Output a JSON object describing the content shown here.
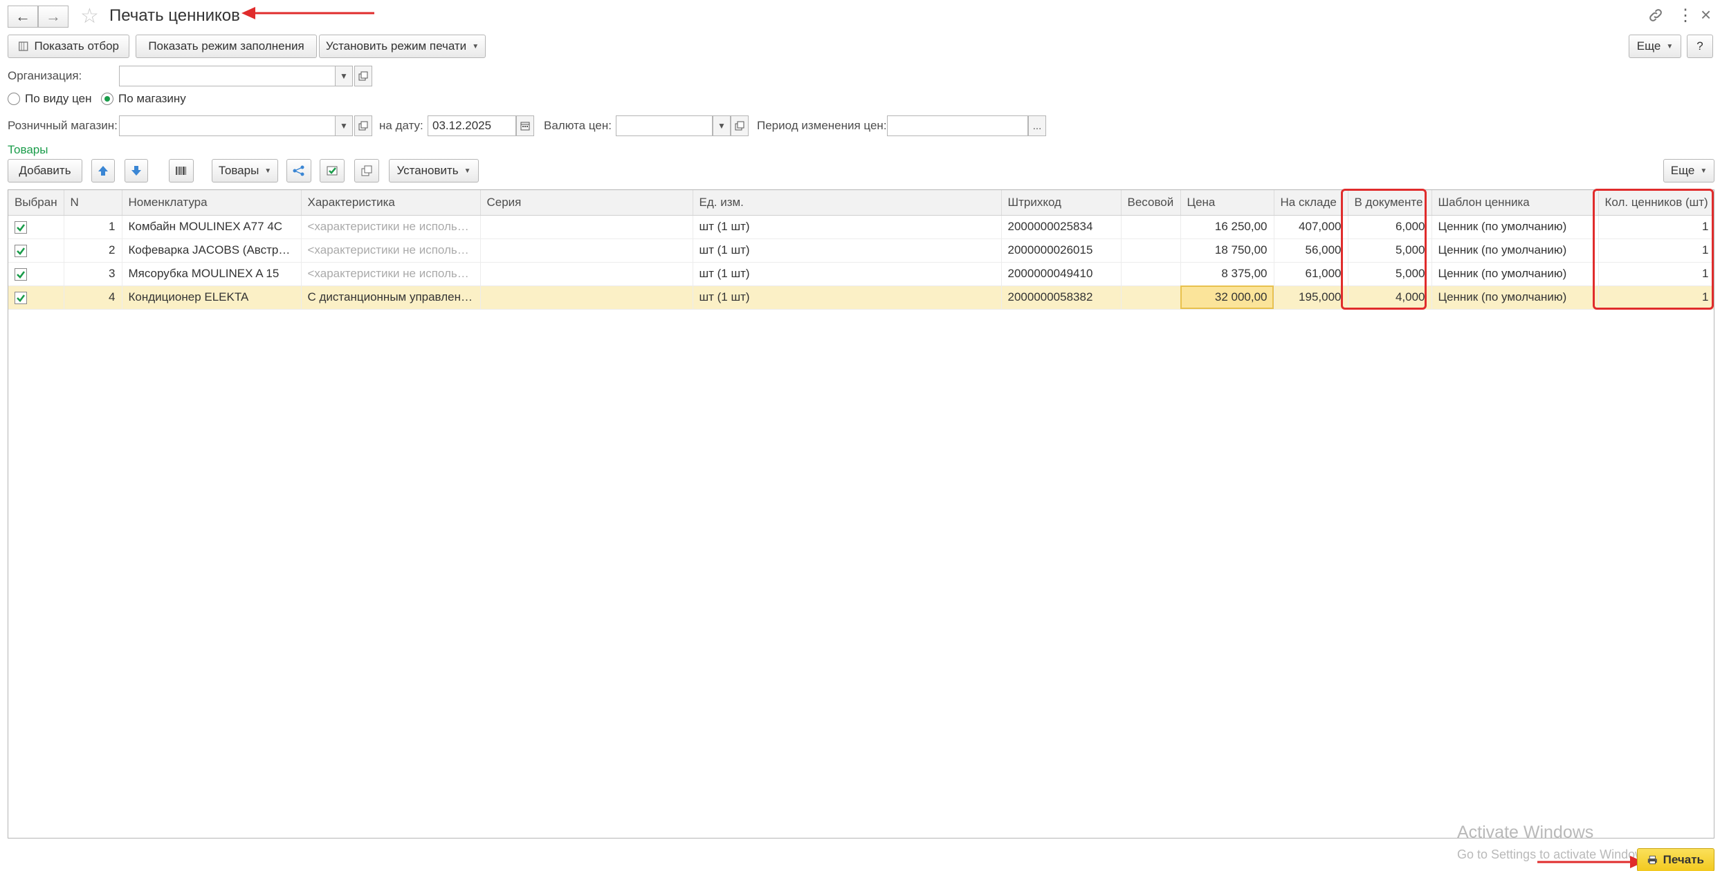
{
  "window": {
    "title": "Печать ценников"
  },
  "toolbar": {
    "show_filter": "Показать отбор",
    "show_fill_mode": "Показать режим заполнения",
    "set_print_mode": "Установить режим печати",
    "more": "Еще",
    "help": "?"
  },
  "filters": {
    "organization_label": "Организация:",
    "organization_value": "",
    "radio_by_price_type": "По виду цен",
    "radio_by_store": "По магазину",
    "radio_selected": "По магазину",
    "store_label": "Розничный магазин:",
    "store_value": "",
    "date_label": "на дату:",
    "date_value": "03.12.2025",
    "currency_label": "Валюта цен:",
    "currency_value": "",
    "period_label": "Период изменения цен:",
    "period_value": "",
    "period_btn": "..."
  },
  "goods": {
    "section_title": "Товары",
    "add": "Добавить",
    "goods_menu": "Товары",
    "set_menu": "Установить",
    "more": "Еще"
  },
  "table": {
    "columns": [
      "Выбран",
      "N",
      "Номенклатура",
      "Характеристика",
      "Серия",
      "Ед. изм.",
      "Штрихкод",
      "Весовой",
      "Цена",
      "На складе",
      "В документе",
      "Шаблон ценника",
      "Кол. ценников (шт)"
    ],
    "rows": [
      {
        "checked": true,
        "n": "1",
        "nomenclature": "Комбайн MOULINEX  A77 4C",
        "characteristic": "<характеристики не используются>",
        "series": "",
        "unit": "шт (1 шт)",
        "barcode": "2000000025834",
        "weight": "",
        "price": "16 250,00",
        "stock": "407,000",
        "in_doc": "6,000",
        "template": "Ценник (по умолчанию)",
        "count": "1"
      },
      {
        "checked": true,
        "n": "2",
        "nomenclature": "Кофеварка JACOBS (Австрия)",
        "characteristic": "<характеристики не используются>",
        "series": "",
        "unit": "шт (1 шт)",
        "barcode": "2000000026015",
        "weight": "",
        "price": "18 750,00",
        "stock": "56,000",
        "in_doc": "5,000",
        "template": "Ценник (по умолчанию)",
        "count": "1"
      },
      {
        "checked": true,
        "n": "3",
        "nomenclature": "Мясорубка MOULINEX  A 15",
        "characteristic": "<характеристики не используются>",
        "series": "",
        "unit": "шт (1 шт)",
        "barcode": "2000000049410",
        "weight": "",
        "price": "8 375,00",
        "stock": "61,000",
        "in_doc": "5,000",
        "template": "Ценник (по умолчанию)",
        "count": "1"
      },
      {
        "checked": true,
        "n": "4",
        "nomenclature": "Кондиционер ELEKTA",
        "characteristic": "С дистанционным управлением",
        "series": "",
        "unit": "шт (1 шт)",
        "barcode": "2000000058382",
        "weight": "",
        "price": "32 000,00",
        "stock": "195,000",
        "in_doc": "4,000",
        "template": "Ценник (по умолчанию)",
        "count": "1"
      }
    ]
  },
  "footer": {
    "print": "Печать"
  },
  "watermark": {
    "line1": "Activate Windows",
    "line2": "Go to Settings to activate Windows."
  },
  "colors": {
    "accent_green": "#1a9c4a",
    "highlight": "#e02c2c",
    "print_button": "#f7d23e"
  }
}
